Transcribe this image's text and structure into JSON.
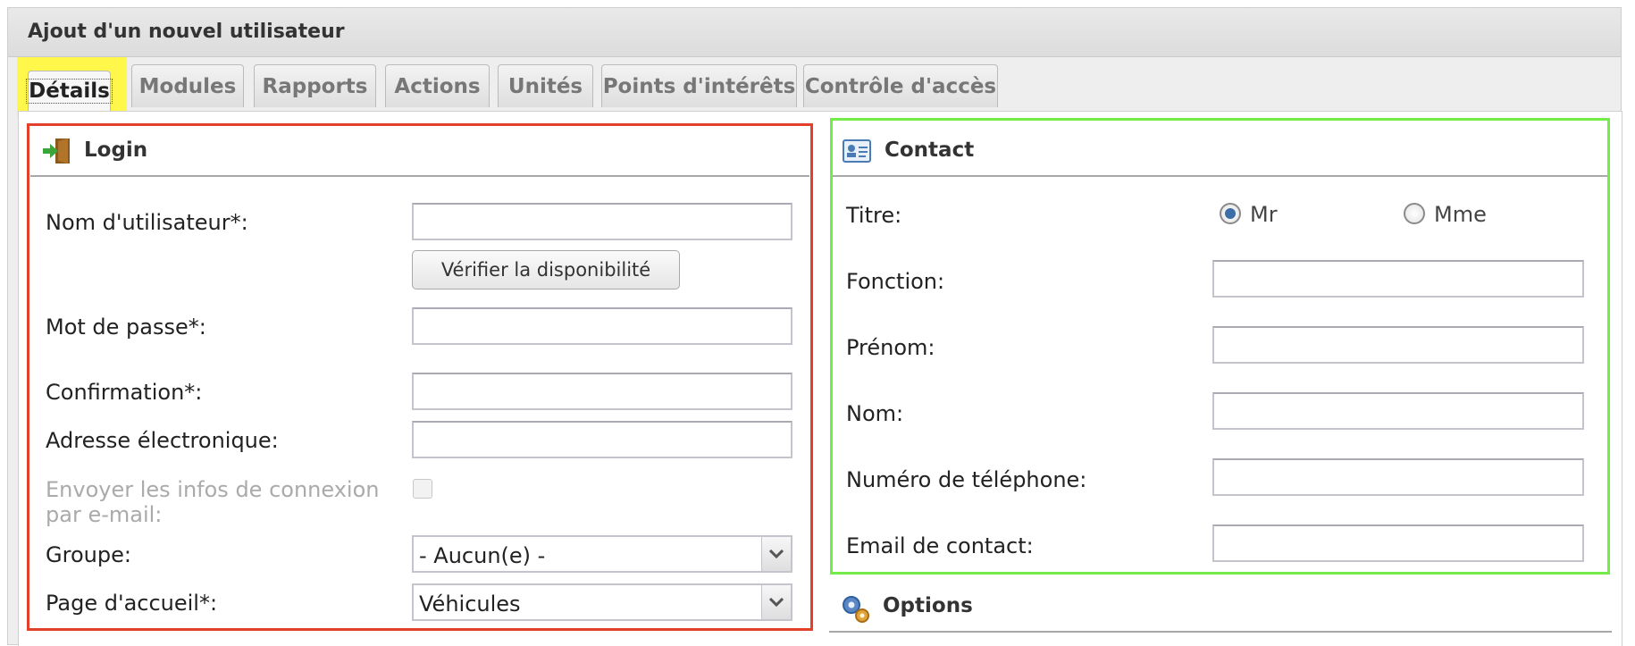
{
  "window": {
    "title": "Ajout d'un nouvel utilisateur"
  },
  "tabs": [
    {
      "label": "Détails",
      "active": true
    },
    {
      "label": "Modules"
    },
    {
      "label": "Rapports"
    },
    {
      "label": "Actions"
    },
    {
      "label": "Unités"
    },
    {
      "label": "Points d'intérêts"
    },
    {
      "label": "Contrôle d'accès"
    }
  ],
  "login": {
    "title": "Login",
    "icon": "login-door-icon",
    "username_label": "Nom d'utilisateur*:",
    "username_value": "",
    "check_button": "Vérifier la disponibilité",
    "password_label": "Mot de passe*:",
    "password_value": "",
    "confirm_label": "Confirmation*:",
    "confirm_value": "",
    "email_label": "Adresse électronique:",
    "email_value": "",
    "send_info_label": "Envoyer les infos de connexion par e-mail:",
    "send_info_checked": false,
    "group_label": "Groupe:",
    "group_value": "- Aucun(e) -",
    "home_label": "Page d'accueil*:",
    "home_value": "Véhicules"
  },
  "contact": {
    "title": "Contact",
    "icon": "contact-card-icon",
    "titre_label": "Titre:",
    "option_mr": "Mr",
    "option_mme": "Mme",
    "selected": "Mr",
    "fonction_label": "Fonction:",
    "prenom_label": "Prénom:",
    "nom_label": "Nom:",
    "phone_label": "Numéro de téléphone:",
    "email_label": "Email de contact:"
  },
  "options": {
    "title": "Options",
    "icon": "gears-icon"
  },
  "annotations": {
    "highlight_tab": "#fff84a",
    "login_box": "#e2402b",
    "contact_box": "#73ec4a"
  }
}
